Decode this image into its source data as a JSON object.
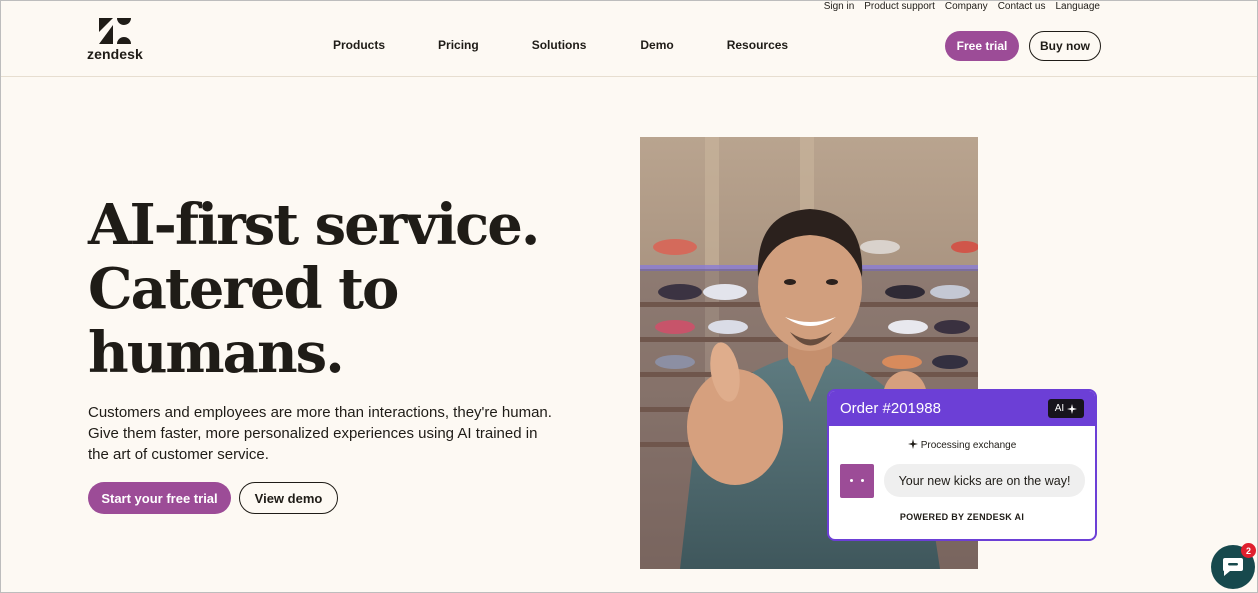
{
  "brand": {
    "logo_text": "zendesk",
    "accent": "#9C4C97",
    "chat_accent": "#6C3FD6",
    "launcher_color": "#17494D"
  },
  "utility_nav": [
    "Sign in",
    "Product support",
    "Company",
    "Contact us",
    "Language"
  ],
  "main_nav": [
    "Products",
    "Pricing",
    "Solutions",
    "Demo",
    "Resources"
  ],
  "header_buttons": {
    "free_trial": "Free trial",
    "buy_now": "Buy now"
  },
  "hero": {
    "title_lines": [
      "AI-first service.",
      "Catered to",
      "humans."
    ],
    "subtitle_lines": [
      "Customers and employees are more than interactions, they're human.",
      "Give them faster, more personalized experiences using AI trained in",
      "the art of customer service."
    ],
    "primary_cta": "Start your free trial",
    "secondary_cta": "View demo"
  },
  "chat_card": {
    "order": "Order #201988",
    "badge": "AI",
    "status": "Processing exchange",
    "message": "Your new kicks are on the way!",
    "powered_by": "POWERED BY ZENDESK AI"
  },
  "launcher": {
    "badge_count": "2"
  },
  "icons": {
    "logo": "zendesk-logo-icon",
    "sparkle": "sparkle-icon",
    "chat": "chat-bubble-icon"
  }
}
